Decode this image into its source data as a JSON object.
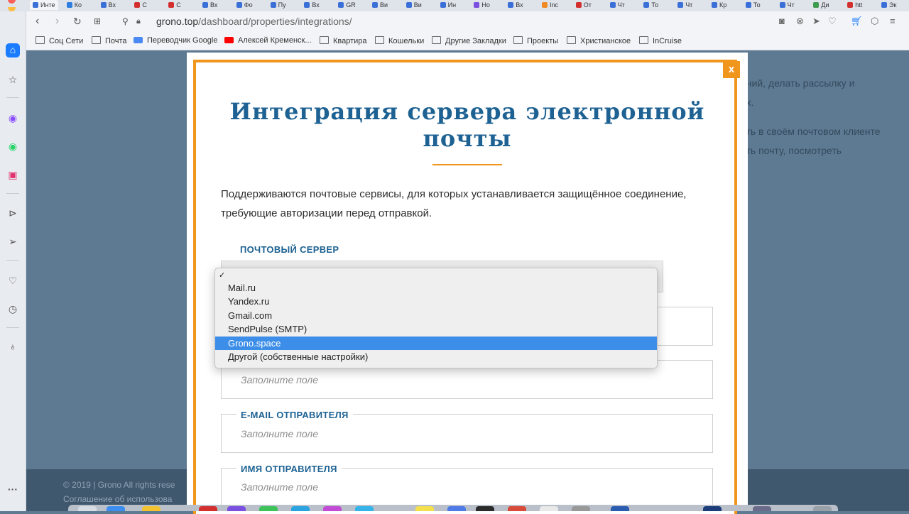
{
  "browser": {
    "tabs": [
      "Инте",
      "Ко",
      "Вх",
      "С",
      "С",
      "Вх",
      "Фо",
      "Пу",
      "Вх",
      "GR",
      "Ви",
      "Ви",
      "Ин",
      "Но",
      "Вх",
      "Inc",
      "От",
      "Чт",
      "То",
      "Чт",
      "Кр",
      "То",
      "Чт",
      "Ди",
      "htt",
      "Эк"
    ],
    "url_domain": "grono.top",
    "url_path": "/dashboard/properties/integrations/",
    "bookmarks": [
      "Соц Сети",
      "Почта",
      "Переводчик Google",
      "Алексей Кременск...",
      "Квартира",
      "Кошельки",
      "Другие Закладки",
      "Проекты",
      "Христианское",
      "InCruise"
    ]
  },
  "background_page": {
    "lines": [
      "ений, делать рассылку и",
      "ах.",
      "ать в своём почтовом клиенте",
      "ать почту, посмотреть"
    ],
    "footer_line1": "© 2019 | Grono All rights rese",
    "footer_line2": "Соглашение об использова"
  },
  "modal": {
    "close_label": "x",
    "title": "Интеграция сервера электронной почты",
    "description": "Поддерживаются почтовые сервисы, для которых устанавливается защищённое соединение, требующие авторизации перед отправкой.",
    "server_label": "ПОЧТОВЫЙ СЕРВЕР",
    "dropdown": {
      "checkmark": "✓",
      "options": [
        "Mail.ru",
        "Yandex.ru",
        "Gmail.com",
        "SendPulse (SMTP)",
        "Grono.space",
        "Другой (собственные настройки)"
      ],
      "highlighted": "Grono.space"
    },
    "field_placeholder": "Заполните поле",
    "sender_email_label": "E-MAIL ОТПРАВИТЕЛЯ",
    "sender_name_label": "ИМЯ ОТПРАВИТЕЛЯ"
  },
  "colors": {
    "accent_orange": "#f0961d",
    "title_blue": "#1e6293",
    "selection_blue": "#3d8ee8",
    "backdrop": "#5e7a93"
  }
}
